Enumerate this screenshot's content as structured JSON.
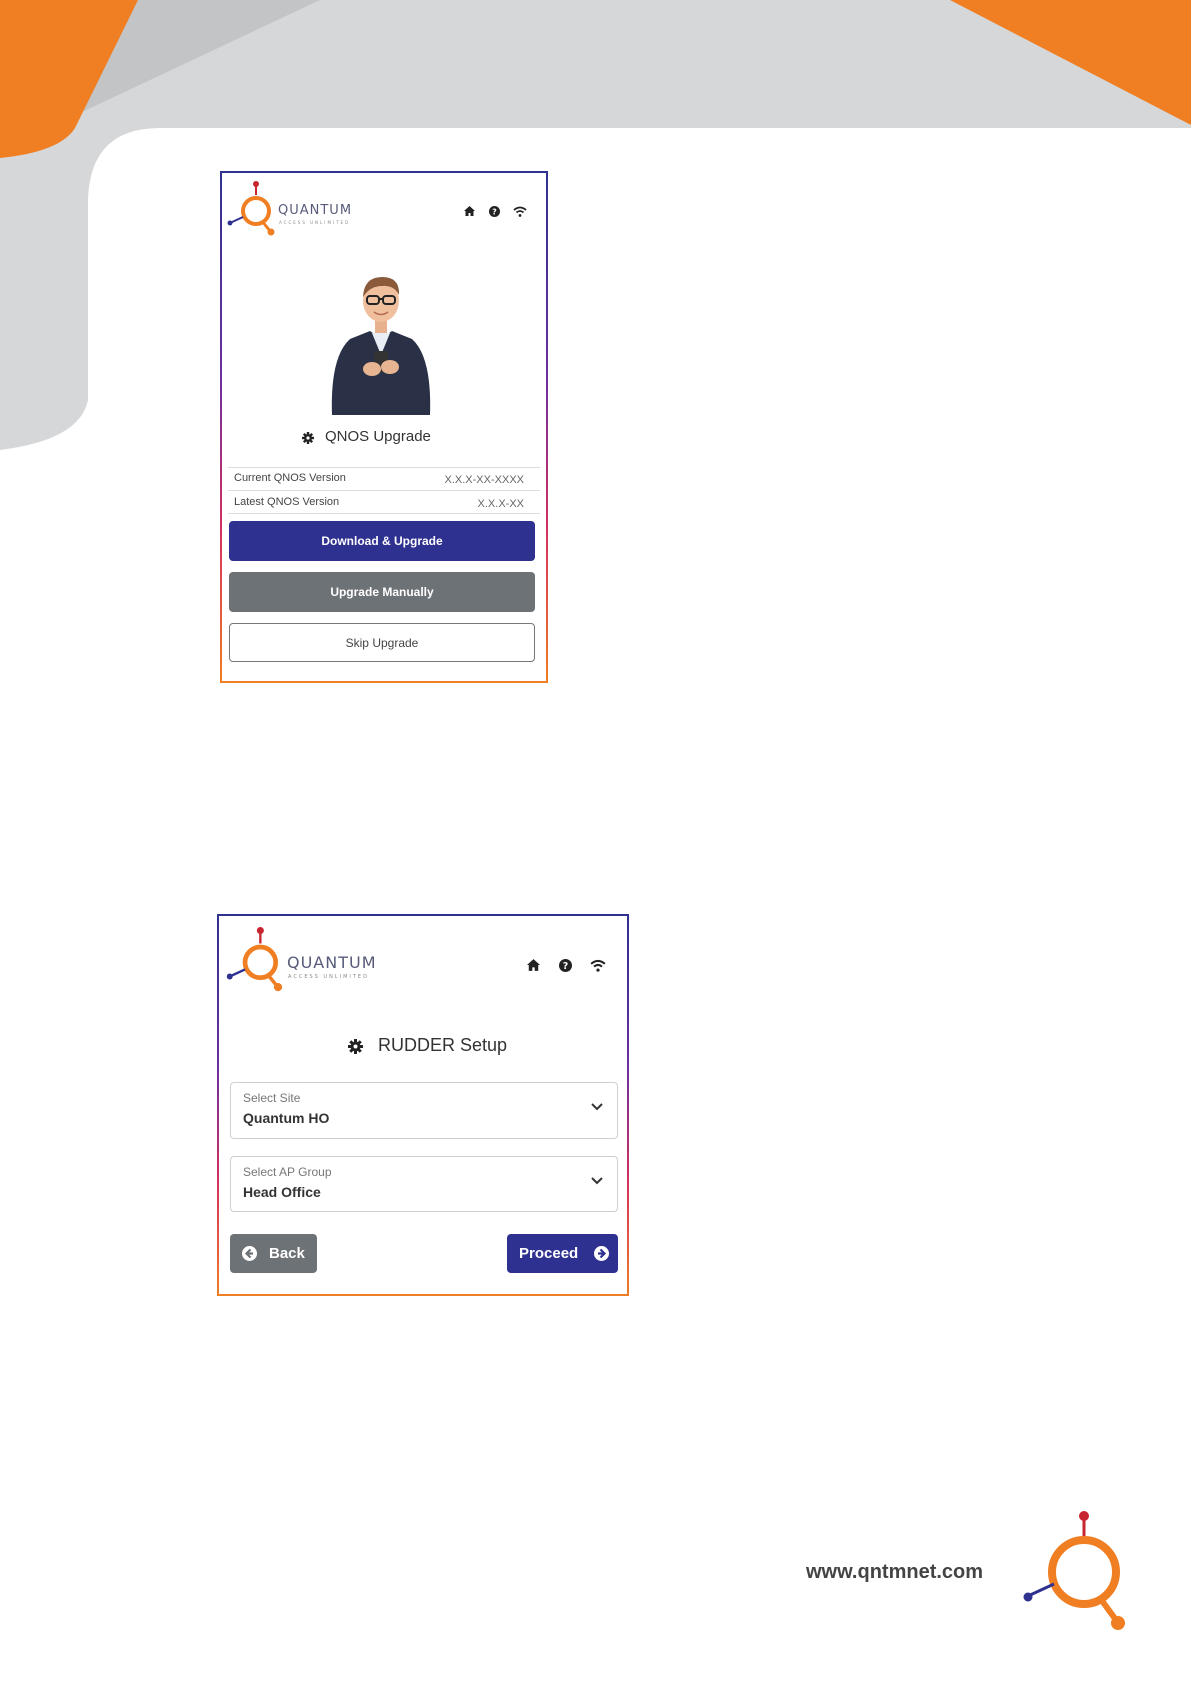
{
  "colors": {
    "brand_orange": "#f07e22",
    "brand_navy": "#2f3190",
    "gray_button": "#6d7277",
    "brand_red": "#c7252f"
  },
  "qnos_screen": {
    "logo": {
      "name": "QUANTUM",
      "tagline": "ACCESS UNLIMITED"
    },
    "header_icons": [
      "home-icon",
      "help-icon",
      "wifi-icon"
    ],
    "illustration": "person-holding-phone",
    "title_icon": "gear-icon",
    "title": "QNOS Upgrade",
    "rows": [
      {
        "label": "Current QNOS Version",
        "value": "X.X.X-XX-XXXX"
      },
      {
        "label": "Latest QNOS Version",
        "value": "X.X.X-XX"
      }
    ],
    "buttons": {
      "download": "Download & Upgrade",
      "manual": "Upgrade Manually",
      "skip": "Skip Upgrade"
    }
  },
  "rudder_screen": {
    "logo": {
      "name": "QUANTUM",
      "tagline": "ACCESS UNLIMITED"
    },
    "header_icons": [
      "home-icon",
      "help-icon",
      "wifi-icon"
    ],
    "title_icon": "gear-icon",
    "title": "RUDDER Setup",
    "site": {
      "label": "Select Site",
      "value": "Quantum HO"
    },
    "ap_group": {
      "label": "Select AP Group",
      "value": "Head Office"
    },
    "buttons": {
      "back": "Back",
      "proceed": "Proceed"
    }
  },
  "footer": {
    "url": "www.qntmnet.com"
  }
}
